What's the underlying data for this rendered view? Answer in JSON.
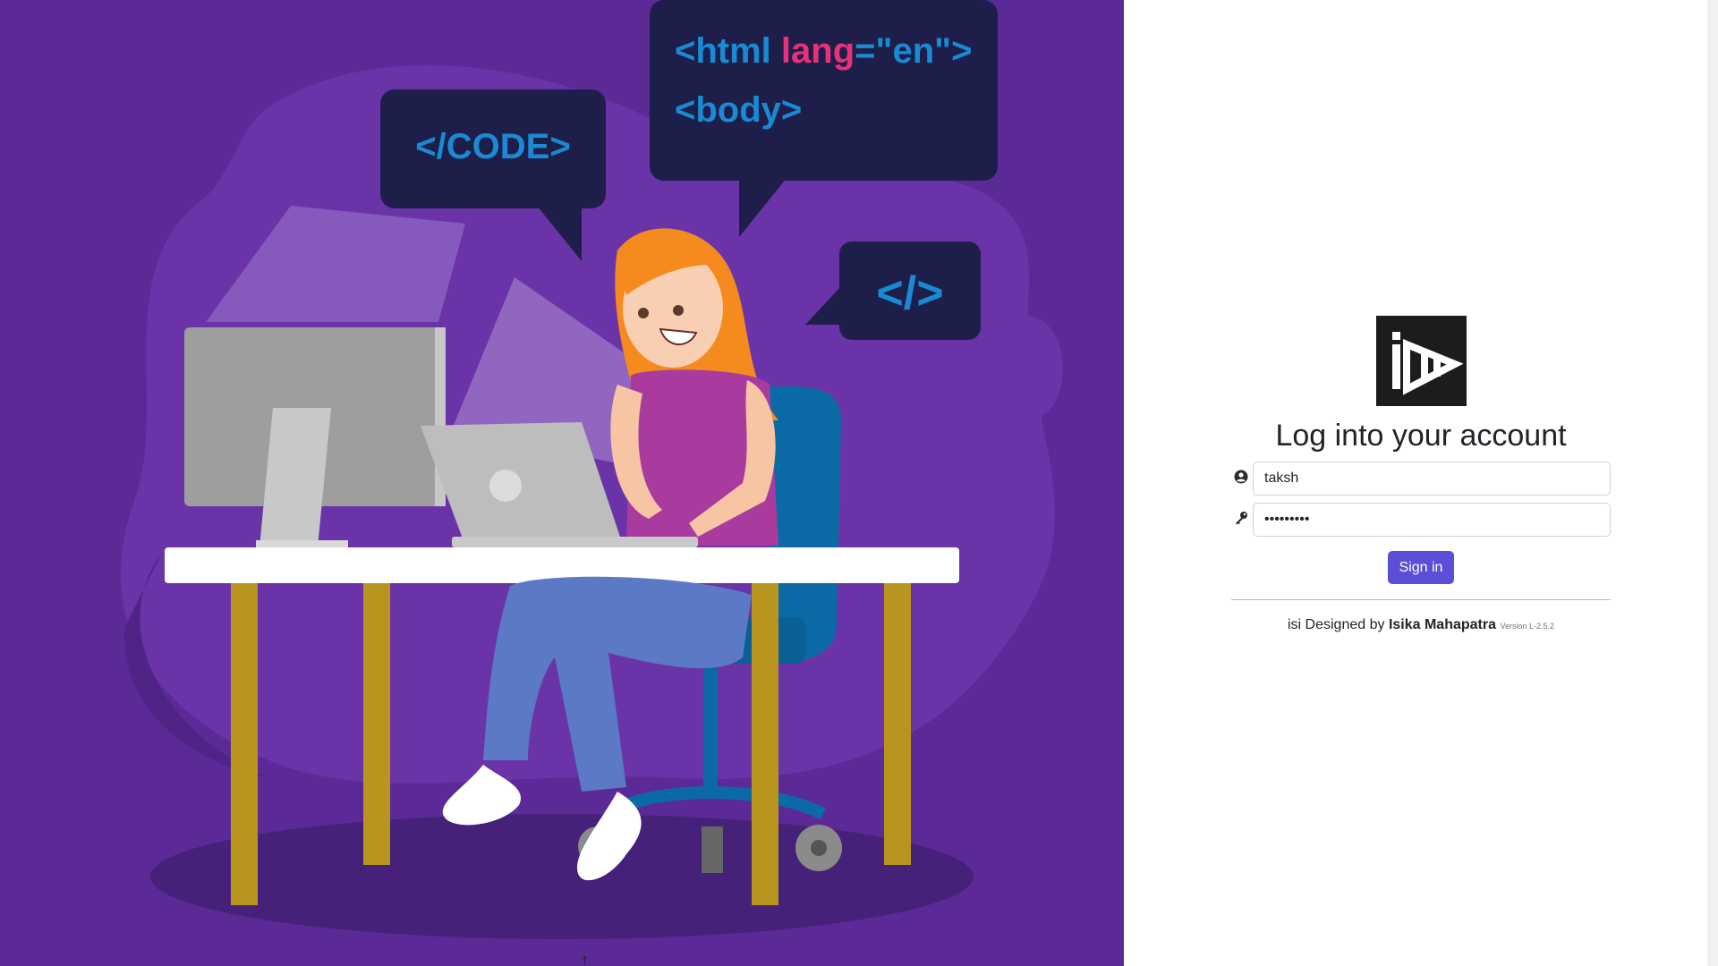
{
  "illustration": {
    "bubble_code": "</CODE>",
    "bubble_html_open": "<html ",
    "bubble_html_attr": "lang",
    "bubble_html_value": "=\"en\">",
    "bubble_body": "<body>",
    "bubble_close_tag": "</>",
    "caption": "† "
  },
  "login": {
    "logo_alt": "isi logo",
    "title": "Log into your account",
    "username_value": "taksh",
    "password_value": "•••••••••",
    "signin_label": "Sign in",
    "footer_prefix": "isi Designed by ",
    "footer_author": "Isika Mahapatra",
    "footer_version": "Version L-2.5.2"
  },
  "colors": {
    "panel_bg": "#5b2a96",
    "bubble_bg": "#1d1f4a",
    "bubble_text": "#1a8ad4",
    "bubble_accent": "#e8317a",
    "signin_bg": "#5a4fd6"
  }
}
